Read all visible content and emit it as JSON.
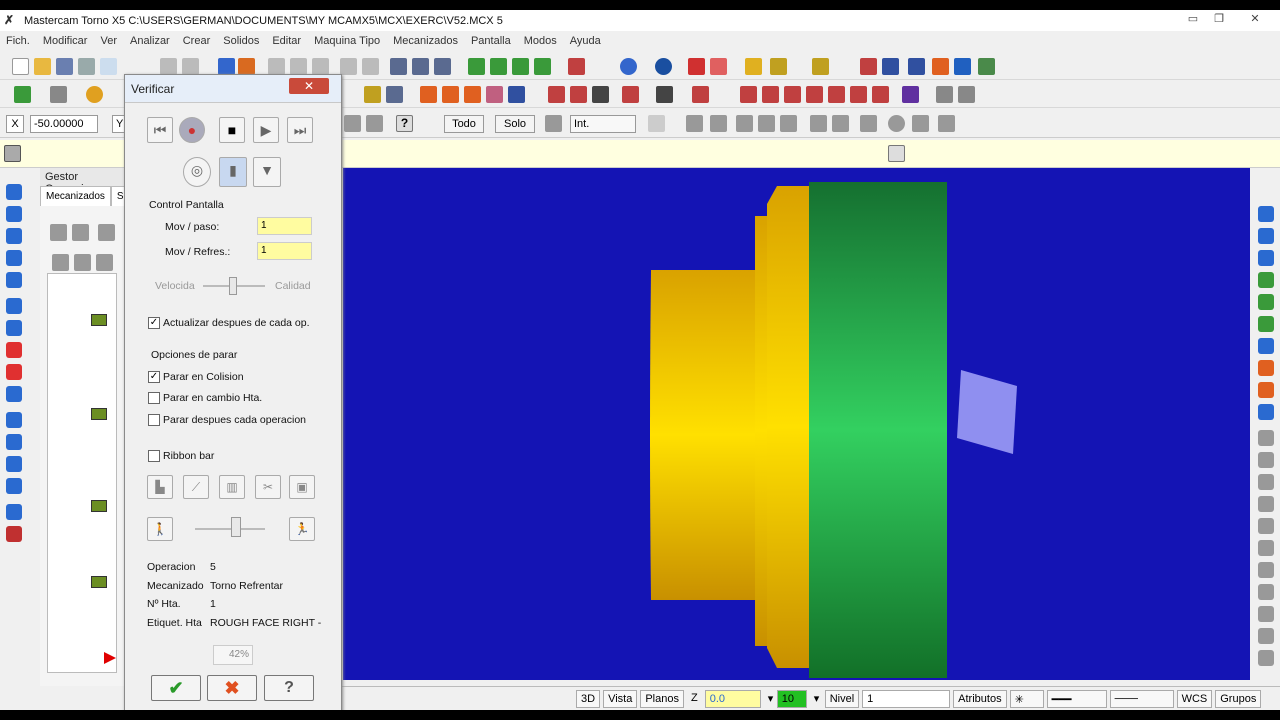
{
  "window": {
    "title": "Mastercam Torno X5  C:\\USERS\\GERMAN\\DOCUMENTS\\MY MCAMX5\\MCX\\EXERC\\V52.MCX  5",
    "minimize": "▭",
    "restore": "❐",
    "close": "✕"
  },
  "menu": [
    "Fich.",
    "Modificar",
    "Ver",
    "Analizar",
    "Crear",
    "Solidos",
    "Editar",
    "Maquina Tipo",
    "Mecanizados",
    "Pantalla",
    "Modos",
    "Ayuda"
  ],
  "ribbon": {
    "x_label": "X",
    "x_value": "-50.00000",
    "y_label": "Y",
    "todo": "Todo",
    "solo": "Solo",
    "int_value": "Int."
  },
  "gestor": {
    "title": "Gestor Operacion",
    "tab_mecanizados": "Mecanizados",
    "tab_so": "So"
  },
  "dialog": {
    "title": "Verificar",
    "close": "✕",
    "control_pantalla": "Control Pantalla",
    "mov_paso_label": "Mov / paso:",
    "mov_paso_value": "1",
    "mov_refres_label": "Mov / Refres.:",
    "mov_refres_value": "1",
    "velocidad": "Velocida",
    "calidad": "Calidad",
    "actualizar": "Actualizar despues de cada op.",
    "opciones_parar": "Opciones de parar",
    "parar_colision": "Parar en Colision",
    "parar_cambio": "Parar en cambio Hta.",
    "parar_despues": "Parar despues cada operacion",
    "ribbon_bar": "Ribbon bar",
    "info": [
      {
        "label": "Operacion",
        "value": "5"
      },
      {
        "label": "Mecanizado",
        "value": "Torno Refrentar"
      },
      {
        "label": "Nº Hta.",
        "value": "1"
      },
      {
        "label": "Etiquet. Hta",
        "value": "ROUGH FACE RIGHT -"
      }
    ],
    "progress": "42%",
    "ok": "✔",
    "cancel": "✖",
    "help": "?"
  },
  "statusbar": {
    "view3d": "3D",
    "vista": "Vista",
    "planos": "Planos",
    "z_label": "Z",
    "z_value": "0.0",
    "color_value": "10",
    "nivel_label": "Nivel",
    "nivel_value": "1",
    "atributos": "Atributos",
    "wcs": "WCS",
    "grupos": "Grupos"
  },
  "colors": {
    "viewport_bg": "#1414b4",
    "part_yellow": "#f2c200",
    "part_green": "#1f8a3a",
    "tool_blue": "#8f8ff0"
  }
}
